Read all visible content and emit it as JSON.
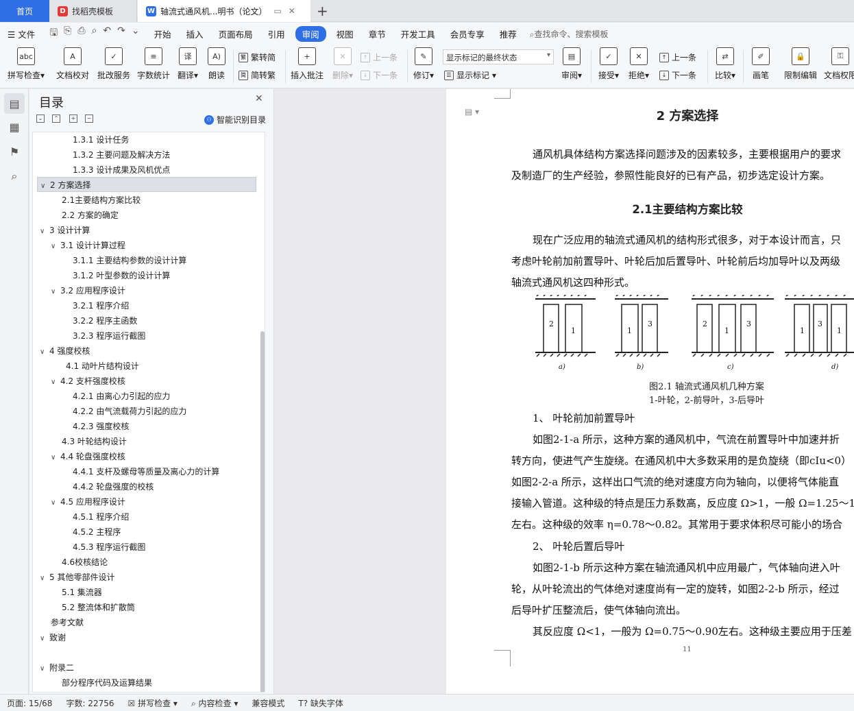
{
  "tabs": {
    "home": "首页",
    "doc1": "找稻壳模板",
    "doc2": "轴流式通风机...明书（论文）"
  },
  "menu": {
    "file": "文件",
    "items": [
      "开始",
      "插入",
      "页面布局",
      "引用",
      "审阅",
      "视图",
      "章节",
      "开发工具",
      "会员专享",
      "推荐"
    ],
    "active": "审阅",
    "search": "查找命令、搜索模板"
  },
  "ribbon": {
    "spell": "拼写检查",
    "doc_check": "文档校对",
    "annot_service": "批改服务",
    "word_count": "字数统计",
    "translate": "翻译",
    "read_aloud": "朗读",
    "to_trad": "繁转简",
    "to_simp": "简转繁",
    "insert_comment": "插入批注",
    "delete": "删除",
    "prev": "上一条",
    "next": "下一条",
    "revise": "修订",
    "markup_state": "显示标记的最终状态",
    "show_markup": "显示标记",
    "review": "审阅",
    "accept": "接受",
    "reject": "拒绝",
    "prev2": "上一条",
    "next2": "下一条",
    "compare": "比较",
    "pen": "画笔",
    "restrict": "限制编辑",
    "doc_perm": "文档权限"
  },
  "toc": {
    "title": "目录",
    "smart": "智能识别目录",
    "items": [
      {
        "label": "1.3.1  设计任务"
      },
      {
        "label": "1.3.2  主要问题及解决方法"
      },
      {
        "label": "1.3.3  设计成果及风机优点"
      },
      {
        "label": "2  方案选择"
      },
      {
        "label": "2.1主要结构方案比较"
      },
      {
        "label": "2.2  方案的确定"
      },
      {
        "label": "3  设计计算"
      },
      {
        "label": "3.1  设计计算过程"
      },
      {
        "label": "3.1.1  主要结构参数的设计计算"
      },
      {
        "label": "3.1.2  叶型参数的设计计算"
      },
      {
        "label": "3.2  应用程序设计"
      },
      {
        "label": "3.2.1  程序介绍"
      },
      {
        "label": "3.2.2  程序主函数"
      },
      {
        "label": "3.2.3  程序运行截图"
      },
      {
        "label": "4  强度校核"
      },
      {
        "label": "4.1  动叶片结构设计"
      },
      {
        "label": "4.2  支杆强度校核"
      },
      {
        "label": "4.2.1  由离心力引起的应力"
      },
      {
        "label": "4.2.2  由气流载荷力引起的应力"
      },
      {
        "label": "4.2.3  强度校核"
      },
      {
        "label": "4.3  叶轮结构设计"
      },
      {
        "label": "4.4  轮盘强度校核"
      },
      {
        "label": "4.4.1  支杆及螺母等质量及离心力的计算"
      },
      {
        "label": "4.4.2  轮盘强度的校核"
      },
      {
        "label": "4.5  应用程序设计"
      },
      {
        "label": "4.5.1  程序介绍"
      },
      {
        "label": "4.5.2  主程序"
      },
      {
        "label": "4.5.3  程序运行截图"
      },
      {
        "label": "4.6校核结论"
      },
      {
        "label": "5  其他零部件设计"
      },
      {
        "label": "5.1  集流器"
      },
      {
        "label": "5.2  整流体和扩散筒"
      },
      {
        "label": "参考文献"
      },
      {
        "label": "致谢"
      },
      {
        "label": "附录二"
      },
      {
        "label": "部分程序代码及运算结果"
      }
    ]
  },
  "document": {
    "heading": "2  方案选择",
    "p1_l1": "通风机具体结构方案选择问题涉及的因素较多，主要根据用户的要求",
    "p1_l2": "及制造厂的生产经验，参照性能良好的已有产品，初步选定设计方案。",
    "subheading": "2.1主要结构方案比较",
    "p2_l1": "现在广泛应用的轴流式通风机的结构形式很多，对于本设计而言，只",
    "p2_l2": "考虑叶轮前加前置导叶、叶轮后加后置导叶、叶轮前后均加导叶以及两级",
    "p2_l3": "轴流式通风机这四种形式。",
    "figure_labels": [
      "a)",
      "b)",
      "c)",
      "d)"
    ],
    "caption1": "图2.1  轴流式通风机几种方案",
    "caption2": "1-叶轮，2-前导叶，3-后导叶",
    "item1": "1、 叶轮前加前置导叶",
    "p3_l1": "如图2-1-a 所示，这种方案的通风机中，气流在前置导叶中加速并折",
    "p3_l2": "转方向，使进气产生旋绕。在通风机中大多数采用的是负旋绕（即cIu<0）",
    "p3_l3": "如图2-2-a 所示，这样出口气流的绝对速度方向为轴向，以便将气体能直",
    "p3_l4": "接输入管道。这种级的特点是压力系数高，反应度 Ω>1，一般 Ω=1.25～1.",
    "p3_l5": "左右。这种级的效率 η=0.78～0.82。其常用于要求体积尽可能小的场合",
    "item2": "2、 叶轮后置后导叶",
    "p4_l1": "如图2-1-b 所示这种方案在轴流通风机中应用最广，气体轴向进入叶",
    "p4_l2": "轮，从叶轮流出的气体绝对速度尚有一定的旋转，如图2-2-b 所示，经过",
    "p4_l3": "后导叶扩压整流后，使气体轴向流出。",
    "p5_l1": "其反应度 Ω<1，一般为 Ω=0.75～0.90左右。这种级主要应用于压差",
    "page_number": "11"
  },
  "status": {
    "page": "页面: 15/68",
    "words": "字数: 22756",
    "spell": "拼写检查",
    "content_check": "内容检查",
    "compat": "兼容模式",
    "missing_font": "缺失字体"
  },
  "colors": {
    "accent": "#2f6fe6",
    "selected_row": "#dde0e6"
  }
}
